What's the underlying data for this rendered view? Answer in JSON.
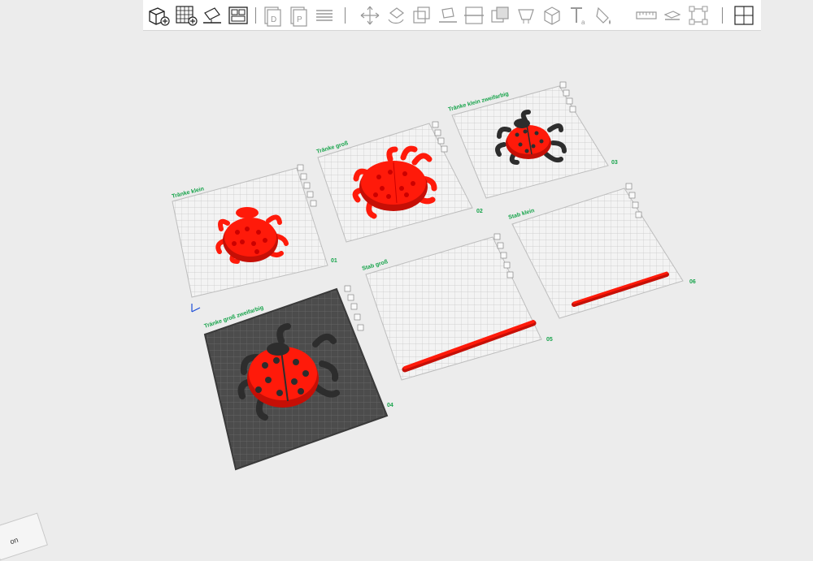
{
  "toolbar": {
    "buttons": [
      {
        "name": "add-object-button",
        "icon": "cube-plus-icon"
      },
      {
        "name": "add-plate-button",
        "icon": "grid-plus-icon"
      },
      {
        "name": "auto-orient-button",
        "icon": "auto-orient-icon"
      },
      {
        "name": "arrange-button",
        "icon": "arrange-icon"
      },
      {
        "name": "plate-d-button",
        "icon": "plate-d-icon"
      },
      {
        "name": "plate-p-button",
        "icon": "plate-p-icon"
      },
      {
        "name": "layers-button",
        "icon": "layers-icon"
      },
      {
        "name": "move-button",
        "icon": "move-icon"
      },
      {
        "name": "rotate-button",
        "icon": "rotate-icon"
      },
      {
        "name": "scale-button",
        "icon": "scale-icon"
      },
      {
        "name": "lay-on-face-button",
        "icon": "lay-on-face-icon"
      },
      {
        "name": "cut-button",
        "icon": "cut-icon"
      },
      {
        "name": "boolean-button",
        "icon": "boolean-icon"
      },
      {
        "name": "support-paint-button",
        "icon": "support-paint-icon"
      },
      {
        "name": "seam-paint-button",
        "icon": "seam-paint-icon"
      },
      {
        "name": "text-emboss-button",
        "icon": "text-emboss-icon"
      },
      {
        "name": "color-paint-button",
        "icon": "color-paint-icon"
      },
      {
        "name": "measure-button",
        "icon": "measure-icon"
      },
      {
        "name": "assembly-button",
        "icon": "assembly-icon"
      },
      {
        "name": "variable-layer-button",
        "icon": "variable-layer-icon"
      },
      {
        "name": "split-objects-button",
        "icon": "split-objects-icon"
      }
    ]
  },
  "plates": [
    {
      "label": "Tränke klein",
      "number": "01"
    },
    {
      "label": "Tränke groß",
      "number": "02"
    },
    {
      "label": "Tränke klein zweifarbig",
      "number": "03"
    },
    {
      "label": "Tränke groß zweifarbig",
      "number": "04"
    },
    {
      "label": "Stab groß",
      "number": "05"
    },
    {
      "label": "Stab klein",
      "number": "06"
    }
  ],
  "corner_tab": {
    "label": "on"
  },
  "colors": {
    "filament_red": "#ff1a0a",
    "filament_dark": "#2d2d2d",
    "plate_light": "#f4f4f4",
    "plate_dark": "#4a4a4a",
    "label_green": "#16a34a"
  }
}
